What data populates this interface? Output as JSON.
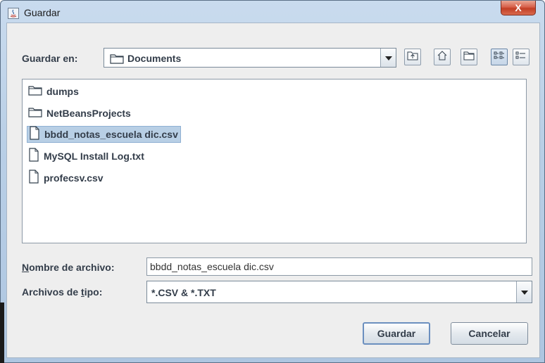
{
  "window": {
    "title": "Guardar",
    "close_label": "X"
  },
  "save_in": {
    "label": "Guardar en:",
    "folder": "Documents"
  },
  "toolbar": [
    {
      "name": "up-one-level-button",
      "icon": "folder-up-icon"
    },
    {
      "name": "home-button",
      "icon": "home-icon"
    },
    {
      "name": "new-folder-button",
      "icon": "new-folder-icon"
    },
    {
      "name": "list-view-button",
      "icon": "list-view-icon",
      "active": true
    },
    {
      "name": "details-view-button",
      "icon": "details-view-icon"
    }
  ],
  "files": [
    {
      "name": "dumps",
      "type": "folder"
    },
    {
      "name": "NetBeansProjects",
      "type": "folder"
    },
    {
      "name": "bbdd_notas_escuela dic.csv",
      "type": "file",
      "selected": true
    },
    {
      "name": "MySQL Install Log.txt",
      "type": "file"
    },
    {
      "name": "profecsv.csv",
      "type": "file"
    }
  ],
  "filename": {
    "label_first": "N",
    "label_rest": "ombre de archivo:",
    "value": "bbdd_notas_escuela dic.csv"
  },
  "filetype": {
    "label_pre": "Archivos de ",
    "label_u": "t",
    "label_post": "ipo:",
    "value": "*.CSV & *.TXT"
  },
  "buttons": {
    "save": "Guardar",
    "cancel": "Cancelar"
  }
}
